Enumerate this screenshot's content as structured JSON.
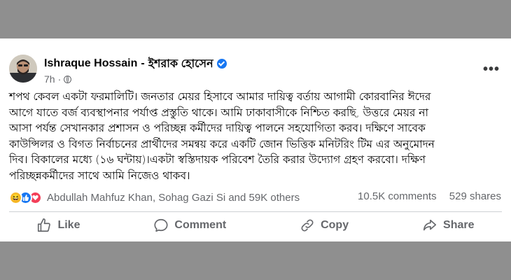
{
  "post": {
    "author_en": "Ishraque Hossain",
    "separator": "-",
    "author_bn": "ইশরাক হোসেন",
    "time": "7h",
    "dot": "·",
    "text": "শপথ কেবল একটা ফরমালিটি। জনতার মেয়র হিসাবে আমার দায়িত্ব বর্তায় আগামী কোরবানির ঈদের\nআগে যাতে বর্জ ব্যবস্থাপনার পর্যাপ্ত প্রস্তুতি থাকে। আমি ঢাকাবাসীকে নিশ্চিত করছি, উত্তরে মেয়র না\nআসা পর্যন্ত সেখানকার প্রশাসন ও পরিচ্ছন্ন কর্মীদের দায়িত্ব পালনে সহযোগিতা করব। দক্ষিণে সাবেক\nকাউন্সিলর ও বিগত নির্বাচনের প্রার্থীদের সমন্বয় করে একটি জোন ভিত্তিক মনিটরিং টিম এর অনুমোদন\nদিব। বিকালের মধ্যে (১৬ ঘন্টায়)।একটা স্বস্তিদায়ক পরিবেশ তৈরি করার উদ্যোগ গ্রহণ করবো। দক্ষিণ\nপরিচ্ছন্নকর্মীদের সাথে আমি নিজেও থাকব।"
  },
  "reactions": {
    "names": "Abdullah Mahfuz Khan, Sohag Gazi Si and 59K others",
    "comments": "10.5K comments",
    "shares": "529 shares",
    "icons": [
      "haha-icon",
      "like-icon",
      "love-icon"
    ]
  },
  "actions": {
    "like": "Like",
    "comment": "Comment",
    "copy": "Copy",
    "share": "Share"
  },
  "colors": {
    "facebook_blue": "#1877f2",
    "love_red": "#f33e58",
    "haha_yellow": "#f7b928",
    "muted_text": "#65676b",
    "background_gray": "#8f8f8f"
  }
}
